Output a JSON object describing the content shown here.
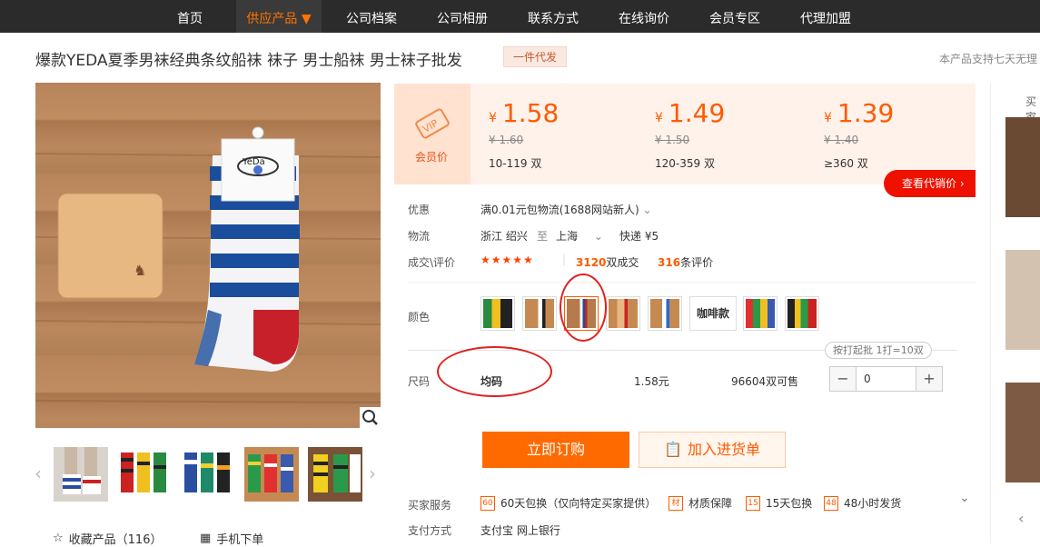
{
  "nav": {
    "items": [
      "首页",
      "供应产品 ▼",
      "公司档案",
      "公司相册",
      "联系方式",
      "在线询价",
      "会员专区",
      "代理加盟"
    ],
    "active_index": 1
  },
  "product": {
    "title": "爆款YEDA夏季男袜经典条纹船袜 袜子 男士船袜 男士袜子批发",
    "tag": "一件代发",
    "support_note": "本产品支持七天无理"
  },
  "gallery": {
    "prev_icon": "‹",
    "next_icon": "›",
    "card_brand": "YeDa"
  },
  "sidebar_actions": {
    "favorite_label": "收藏产品（116）",
    "mobile_label": "手机下单"
  },
  "pricing": {
    "vip_label": "会员价",
    "tiers": [
      {
        "currency": "¥",
        "price": "1.58",
        "old_price": "¥ 1.60",
        "range": "10-119 双"
      },
      {
        "currency": "¥",
        "price": "1.49",
        "old_price": "¥ 1.50",
        "range": "120-359 双"
      },
      {
        "currency": "¥",
        "price": "1.39",
        "old_price": "¥ 1.40",
        "range": "≥360 双"
      }
    ],
    "agent_button": "查看代销价 ›"
  },
  "info": {
    "promo_label": "优惠",
    "promo_value": "满0.01元包物流(1688网站新人)",
    "logistics_label": "物流",
    "from": "浙江 绍兴",
    "to_word": "至",
    "to": "上海",
    "express": "快递 ¥5",
    "trade_label": "成交\\评价",
    "stars": "★★★★★",
    "deals_count": "3120",
    "deals_suffix": "双成交",
    "reviews_count": "316",
    "reviews_suffix": "条评价"
  },
  "color": {
    "label": "颜色",
    "text_swatch": "咖啡款"
  },
  "size": {
    "label": "尺码",
    "hint": "按打起批 1打=10双",
    "value": "均码",
    "price": "1.58元",
    "stock": "96604双可售",
    "qty": "0",
    "minus": "−",
    "plus": "+"
  },
  "actions": {
    "buy": "立即订购",
    "cart": "加入进货单"
  },
  "service": {
    "label": "买家服务",
    "items": [
      {
        "icon": "60",
        "text": "60天包换（仅向特定买家提供）"
      },
      {
        "icon": "材",
        "text": "材质保障"
      },
      {
        "icon": "15",
        "text": "15天包换"
      },
      {
        "icon": "48",
        "text": "48小时发货"
      }
    ]
  },
  "payment": {
    "label": "支付方式",
    "value": "支付宝   网上银行"
  },
  "right_panel": {
    "title": "买家"
  }
}
